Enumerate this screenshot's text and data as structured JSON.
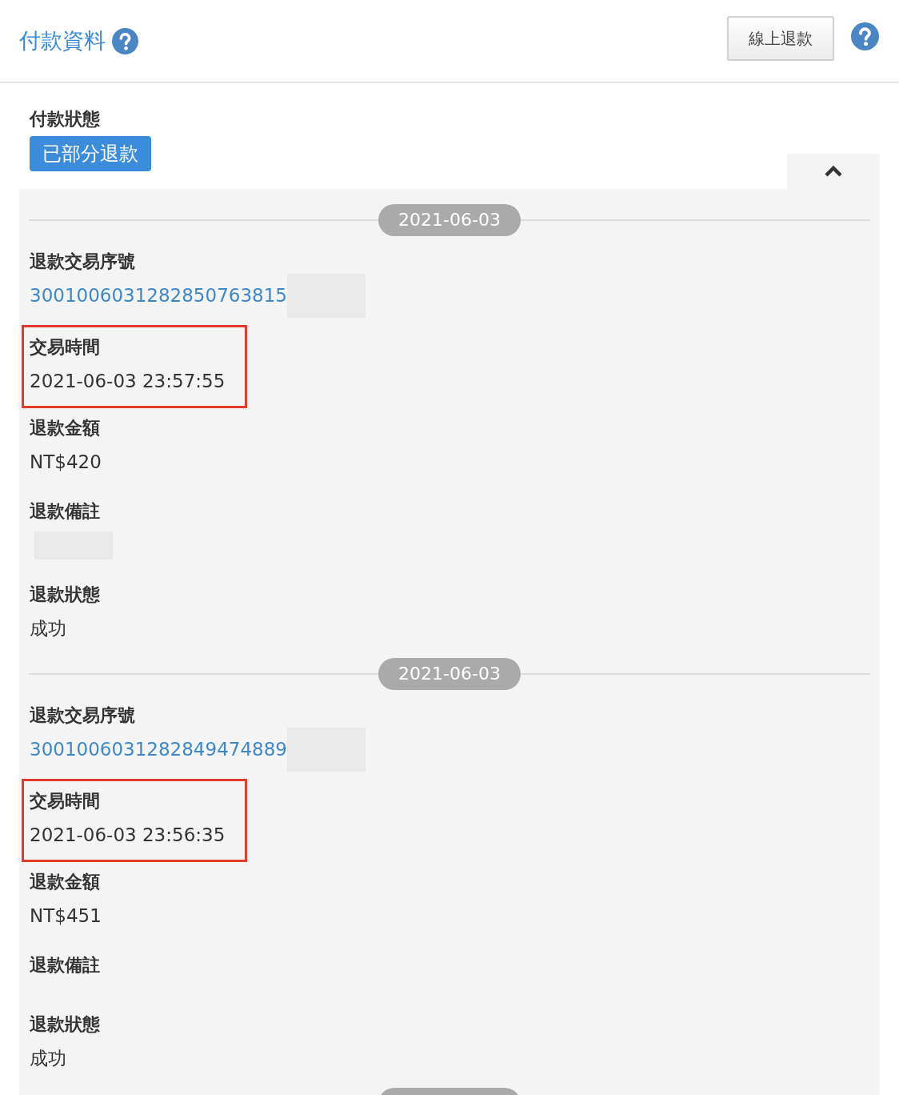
{
  "header": {
    "title": "付款資料",
    "button": "線上退款"
  },
  "payment_status": {
    "label": "付款狀態",
    "badge": "已部分退款"
  },
  "panel": {
    "expanded": true
  },
  "refunds": [
    {
      "date": "2021-06-03",
      "fields": [
        {
          "label": "退款交易序號",
          "value": "3001006031282850763815",
          "kind": "link",
          "highlighted": false,
          "redacted": true
        },
        {
          "label": "交易時間",
          "value": "2021-06-03 23:57:55",
          "kind": "text",
          "highlighted": true,
          "redacted": false
        },
        {
          "label": "退款金額",
          "value": "NT$420",
          "kind": "text",
          "highlighted": false,
          "redacted": false
        },
        {
          "label": "退款備註",
          "kind": "text",
          "highlighted": false,
          "redacted": true
        },
        {
          "label": "退款狀態",
          "value": "成功",
          "kind": "text",
          "highlighted": false,
          "redacted": false
        }
      ]
    },
    {
      "date": "2021-06-03",
      "fields": [
        {
          "label": "退款交易序號",
          "value": "3001006031282849474889",
          "kind": "link",
          "highlighted": false,
          "redacted": true
        },
        {
          "label": "交易時間",
          "value": "2021-06-03 23:56:35",
          "kind": "text",
          "highlighted": true,
          "redacted": false
        },
        {
          "label": "退款金額",
          "value": "NT$451",
          "kind": "text",
          "highlighted": false,
          "redacted": false
        },
        {
          "label": "退款備註",
          "kind": "text",
          "highlighted": false,
          "redacted": false
        },
        {
          "label": "退款狀態",
          "value": "成功",
          "kind": "text",
          "highlighted": false,
          "redacted": false
        }
      ]
    }
  ]
}
